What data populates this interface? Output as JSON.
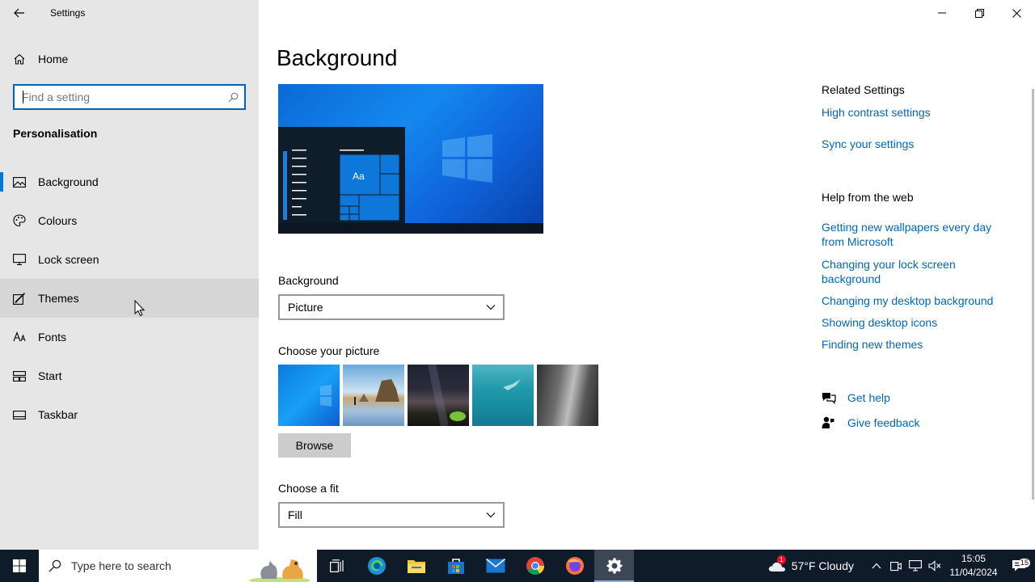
{
  "window": {
    "app_title": "Settings",
    "controls": [
      "minimize",
      "restore",
      "close"
    ]
  },
  "sidebar": {
    "home_label": "Home",
    "search_placeholder": "Find a setting",
    "section_title": "Personalisation",
    "items": [
      {
        "label": "Background",
        "icon": "picture-icon",
        "selected": true
      },
      {
        "label": "Colours",
        "icon": "palette-icon"
      },
      {
        "label": "Lock screen",
        "icon": "monitor-icon"
      },
      {
        "label": "Themes",
        "icon": "brush-icon",
        "hovered": true
      },
      {
        "label": "Fonts",
        "icon": "font-icon"
      },
      {
        "label": "Start",
        "icon": "start-tiles-icon"
      },
      {
        "label": "Taskbar",
        "icon": "taskbar-icon"
      }
    ]
  },
  "main": {
    "title": "Background",
    "preview_tile_text": "Aa",
    "background_label": "Background",
    "background_value": "Picture",
    "choose_picture_label": "Choose your picture",
    "browse_label": "Browse",
    "choose_fit_label": "Choose a fit",
    "fit_value": "Fill"
  },
  "related": {
    "title": "Related Settings",
    "links": [
      "High contrast settings",
      "Sync your settings"
    ]
  },
  "help_web": {
    "title": "Help from the web",
    "links": [
      "Getting new wallpapers every day from Microsoft",
      "Changing your lock screen background",
      "Changing my desktop background",
      "Showing desktop icons",
      "Finding new themes"
    ]
  },
  "help_actions": {
    "get_help": "Get help",
    "give_feedback": "Give feedback"
  },
  "taskbar": {
    "search_placeholder": "Type here to search",
    "weather": "57°F  Cloudy",
    "weather_badge": "1",
    "time": "15:05",
    "date": "11/04/2024",
    "notification_count": "15"
  },
  "colors": {
    "accent": "#0078d7",
    "link": "#0067b8",
    "sidebar_bg": "#e6e6e6",
    "taskbar_bg": "#101b2a"
  }
}
